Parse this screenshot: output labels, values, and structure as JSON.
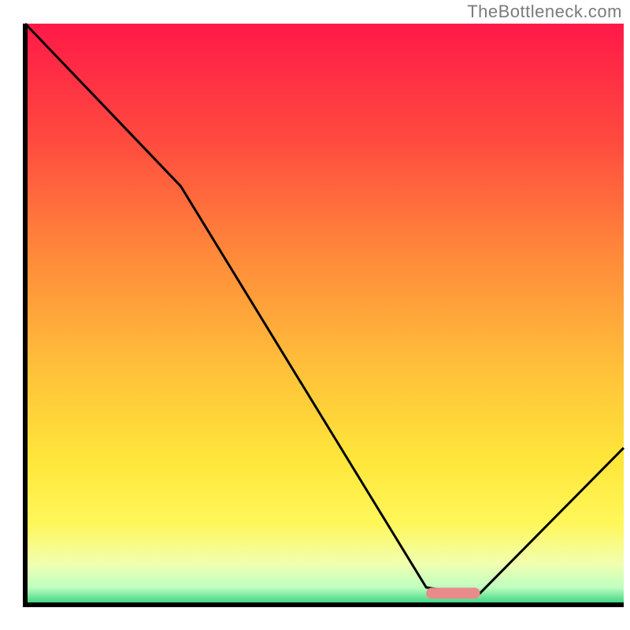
{
  "watermark": "TheBottleneck.com",
  "chart_data": {
    "type": "line",
    "title": "",
    "xlabel": "",
    "ylabel": "",
    "xlim": [
      0,
      100
    ],
    "ylim": [
      0,
      100
    ],
    "series": [
      {
        "name": "bottleneck-curve",
        "x": [
          0,
          26,
          67,
          73,
          76,
          100
        ],
        "values": [
          100,
          72,
          3,
          2,
          2,
          27
        ]
      }
    ],
    "marker": {
      "name": "optimal-region",
      "x_range": [
        67,
        76
      ],
      "y": 2,
      "color": "#e98b8b"
    },
    "gradient_stops": [
      {
        "offset": 0.0,
        "color": "#ff1948"
      },
      {
        "offset": 0.2,
        "color": "#ff4a3f"
      },
      {
        "offset": 0.4,
        "color": "#ff8a3a"
      },
      {
        "offset": 0.6,
        "color": "#ffc23a"
      },
      {
        "offset": 0.75,
        "color": "#ffe63a"
      },
      {
        "offset": 0.86,
        "color": "#fff75a"
      },
      {
        "offset": 0.93,
        "color": "#f0ffb0"
      },
      {
        "offset": 0.97,
        "color": "#c0ffc0"
      },
      {
        "offset": 1.0,
        "color": "#2fd07a"
      }
    ]
  }
}
